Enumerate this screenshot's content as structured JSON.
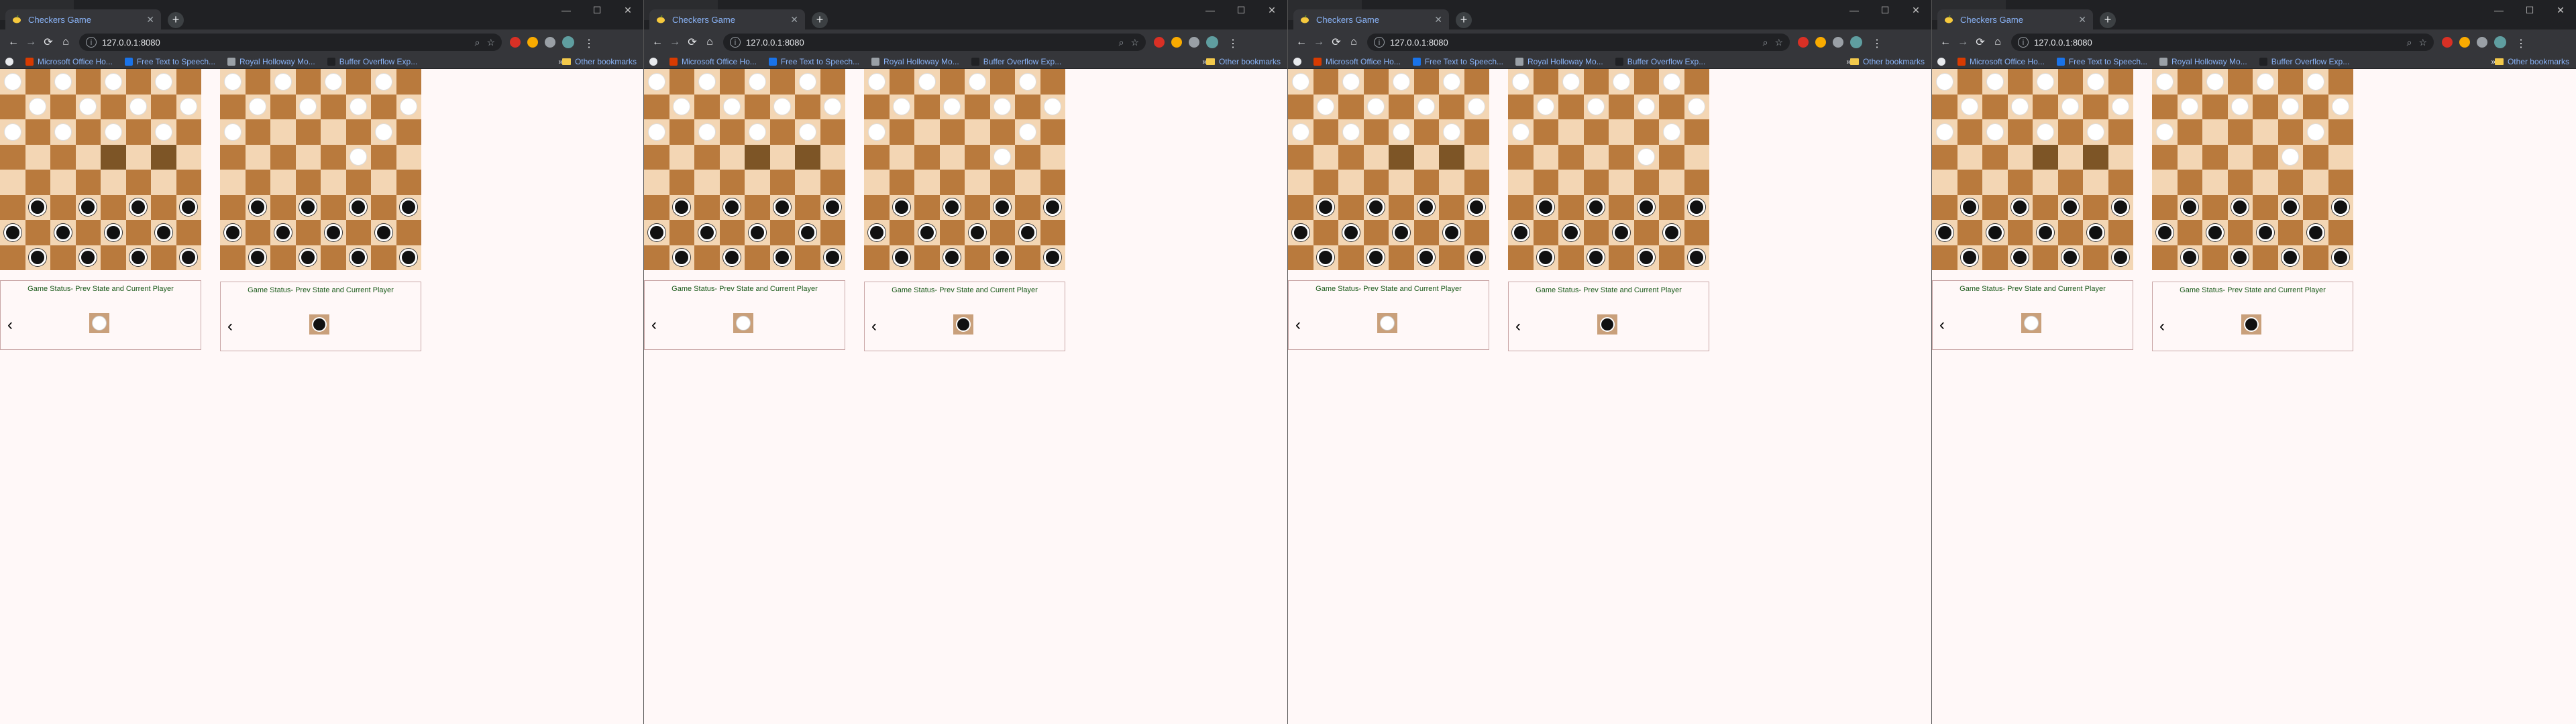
{
  "browser": {
    "tab_title": "Checkers Game",
    "new_tab_symbol": "+",
    "url": "127.0.0.1:8080",
    "window_controls": [
      "—",
      "☐",
      "✕"
    ],
    "nav": {
      "back": "←",
      "forward": "→",
      "reload": "⟳",
      "home": "⌂"
    },
    "bookmarks": [
      {
        "label": "Microsoft Office Ho...",
        "color": "#d83b01"
      },
      {
        "label": "Free Text to Speech...",
        "color": "#1a73e8"
      },
      {
        "label": "Royal Holloway Mo...",
        "color": "#9aa0a6"
      },
      {
        "label": "Buffer Overflow Exp...",
        "color": "#202124"
      }
    ],
    "bookmarks_more": "»",
    "other_bookmarks": "Other bookmarks"
  },
  "game": {
    "status_title": "Game Status- Prev State and Current Player",
    "back_symbol": "‹",
    "board_colors": {
      "light": "#f3d6b4",
      "dark": "#b97a3d",
      "highlight": "#7d5526"
    },
    "boards": [
      {
        "rows": [
          "W.W.W.W.",
          ".W.W.W.W",
          "W.W.W.W.",
          "........",
          "........",
          ".B.B.B.B",
          "B.B.B.B.",
          ".B.B.B.B"
        ],
        "highlights": [
          [
            3,
            4
          ],
          [
            3,
            6
          ]
        ],
        "current_player": "white"
      },
      {
        "rows": [
          "W.W.W.W.",
          ".W.W.W.W",
          "W.....W.",
          ".....W..",
          "........",
          ".B.B.B.B",
          "B.B.B.B.",
          ".B.B.B.B"
        ],
        "highlights": [],
        "current_player": "black"
      }
    ]
  },
  "window_count": 4
}
